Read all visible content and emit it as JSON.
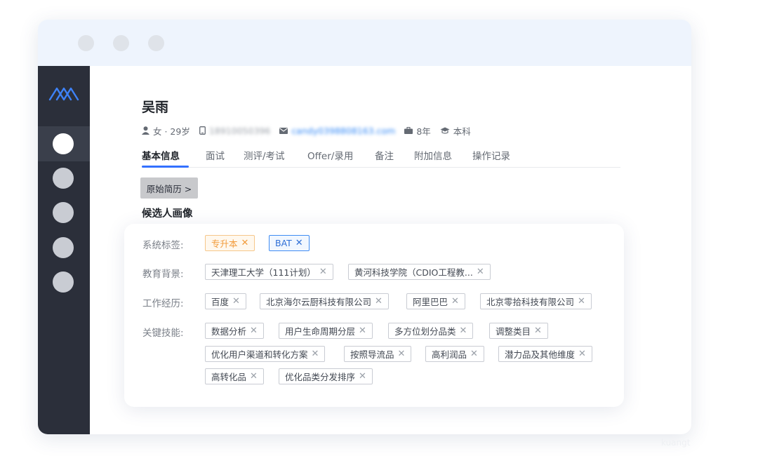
{
  "window": {
    "dots": 3
  },
  "sidebar": {
    "logo": "m-logo-icon",
    "items": [
      "nav-item-1",
      "nav-item-2",
      "nav-item-3",
      "nav-item-4",
      "nav-item-5"
    ],
    "active_index": 0
  },
  "candidate": {
    "name": "吴雨",
    "gender_age": "女 · 29岁",
    "phone": "18910050396",
    "email": "candy0398808163.com",
    "experience": "8年",
    "education": "本科"
  },
  "tabs": [
    {
      "label": "基本信息",
      "active": true
    },
    {
      "label": "面试"
    },
    {
      "label": "测评/考试"
    },
    {
      "label": "Offer/录用"
    },
    {
      "label": "备注"
    },
    {
      "label": "附加信息"
    },
    {
      "label": "操作记录"
    }
  ],
  "resume_button": "原始简历 >",
  "section_title": "候选人画像",
  "portrait": {
    "labels": {
      "system_tags": "系统标签:",
      "education": "教育背景:",
      "work": "工作经历:",
      "skills": "关键技能:"
    },
    "system_tags": [
      "专升本",
      "BAT"
    ],
    "education": [
      "天津理工大学（111计划）",
      "黄河科技学院（CDIO工程教..."
    ],
    "work": [
      "百度",
      "北京海尔云厨科技有限公司",
      "阿里巴巴",
      "北京零拾科技有限公司"
    ],
    "skills": [
      "数据分析",
      "用户生命周期分层",
      "多方位划分品类",
      "调整类目",
      "优化用户渠道和转化方案",
      "按照导流品",
      "高利润品",
      "潜力品及其他维度",
      "高转化品",
      "优化品类分发排序"
    ],
    "remove_glyph": "✕"
  },
  "watermark": "kuangt",
  "colors": {
    "accent": "#3370ff",
    "sidebar": "#2b2f3a",
    "tag_orange": "#f29b3b",
    "tag_blue": "#2f6fd6"
  }
}
